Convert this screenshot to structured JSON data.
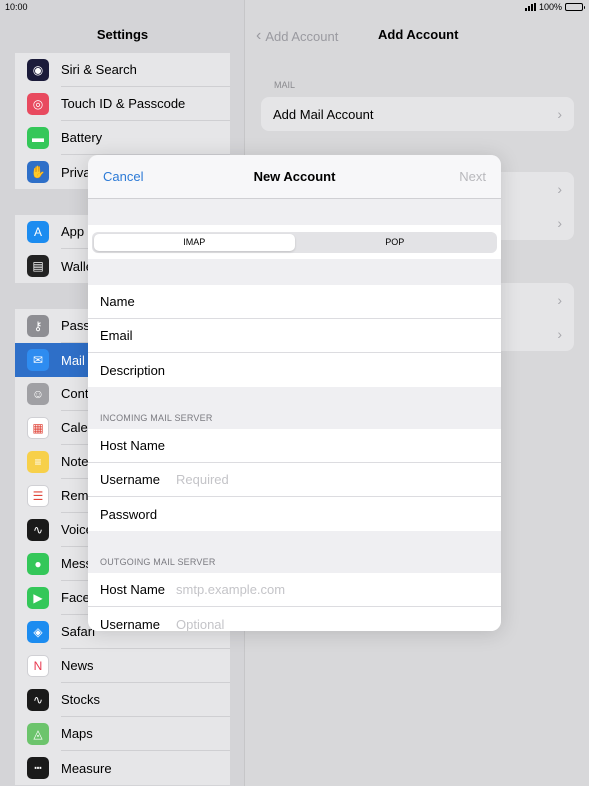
{
  "status": {
    "time": "10:00",
    "battery": "100%"
  },
  "left": {
    "title": "Settings",
    "group1": [
      {
        "label": "Siri & Search",
        "icon": "siri-icon",
        "color": "#1b1b3a"
      },
      {
        "label": "Touch ID & Passcode",
        "icon": "fingerprint-icon",
        "color": "#e84a5f"
      },
      {
        "label": "Battery",
        "icon": "battery-icon",
        "color": "#34c759"
      },
      {
        "label": "Priva",
        "icon": "hand-icon",
        "color": "#2e6fc8"
      }
    ],
    "group2": [
      {
        "label": "App",
        "icon": "app-store-icon",
        "color": "#1c8cf0"
      },
      {
        "label": "Walle",
        "icon": "wallet-icon",
        "color": "#222"
      }
    ],
    "group3": [
      {
        "label": "Pass",
        "icon": "key-icon",
        "color": "#8e8e93"
      },
      {
        "label": "Mail",
        "icon": "mail-icon",
        "color": "#2e8cf0",
        "selected": true
      },
      {
        "label": "Conta",
        "icon": "contacts-icon",
        "color": "#a0a0a4"
      },
      {
        "label": "Cale",
        "icon": "calendar-icon",
        "color": "#ffffff"
      },
      {
        "label": "Note",
        "icon": "notes-icon",
        "color": "#f7d04a"
      },
      {
        "label": "Remi",
        "icon": "reminders-icon",
        "color": "#ffffff"
      },
      {
        "label": "Voice",
        "icon": "voice-memos-icon",
        "color": "#1a1a1a"
      },
      {
        "label": "Mess",
        "icon": "messages-icon",
        "color": "#34c759"
      },
      {
        "label": "Face",
        "icon": "facetime-icon",
        "color": "#34c759"
      },
      {
        "label": "Safari",
        "icon": "safari-icon",
        "color": "#1c8cf0"
      },
      {
        "label": "News",
        "icon": "news-icon",
        "color": "#ffffff"
      },
      {
        "label": "Stocks",
        "icon": "stocks-icon",
        "color": "#1a1a1a"
      },
      {
        "label": "Maps",
        "icon": "maps-icon",
        "color": "#6cc46c"
      },
      {
        "label": "Measure",
        "icon": "measure-icon",
        "color": "#1a1a1a"
      }
    ]
  },
  "right": {
    "back_label": "Add Account",
    "title": "Add Account",
    "section": "MAIL",
    "add_mail_label": "Add Mail Account"
  },
  "modal": {
    "cancel": "Cancel",
    "title": "New Account",
    "next": "Next",
    "tabs": [
      {
        "label": "IMAP",
        "active": true
      },
      {
        "label": "POP",
        "active": false
      }
    ],
    "fields": [
      {
        "label": "Name",
        "placeholder": ""
      },
      {
        "label": "Email",
        "placeholder": ""
      },
      {
        "label": "Description",
        "placeholder": ""
      }
    ],
    "incoming_label": "INCOMING MAIL SERVER",
    "incoming": [
      {
        "label": "Host Name",
        "placeholder": ""
      },
      {
        "label": "Username",
        "placeholder": "Required"
      },
      {
        "label": "Password",
        "placeholder": ""
      }
    ],
    "outgoing_label": "OUTGOING MAIL SERVER",
    "outgoing": [
      {
        "label": "Host Name",
        "placeholder": "smtp.example.com"
      },
      {
        "label": "Username",
        "placeholder": "Optional"
      }
    ]
  }
}
